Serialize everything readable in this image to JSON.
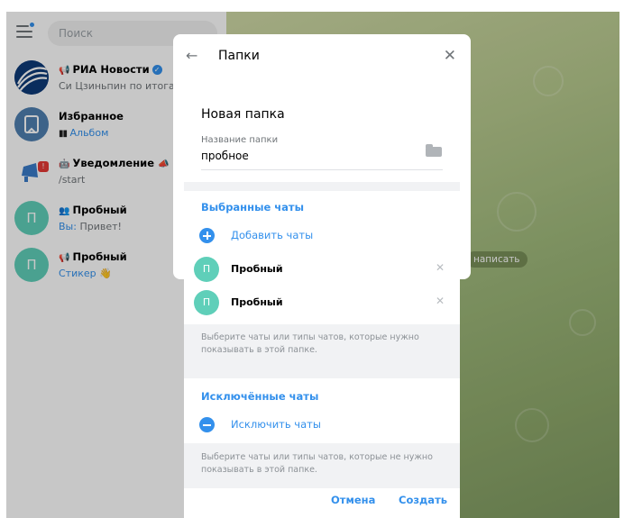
{
  "sidebar": {
    "search_placeholder": "Поиск",
    "chats": [
      {
        "title": "РИА Новости",
        "prefix": "📢",
        "subtitle": "Си Цзиньпин по итогам",
        "avatar": "",
        "color": "#1a4a8a"
      },
      {
        "title": "Избранное",
        "subtitle_blocks": "▮▮",
        "subtitle": "Альбом",
        "avatar": "",
        "color": "#4f7fb0"
      },
      {
        "title": "Уведомление",
        "prefix": "🤖",
        "title_suffix": "📣",
        "subtitle": "/start",
        "badge": "!",
        "color": "#6aa0d8"
      },
      {
        "title": "Пробный",
        "prefix": "👥",
        "sender": "Вы:",
        "subtitle": "Привет!",
        "avatar": "П",
        "color": "#5fcfb9"
      },
      {
        "title": "Пробный",
        "prefix": "📢",
        "subtitle": "Стикер 👋",
        "avatar": "П",
        "color": "#5fcfb9"
      }
    ]
  },
  "folders_panel": {
    "title": "Папки"
  },
  "write_pill": "написать",
  "dialog": {
    "title": "Новая папка",
    "folder_name_label": "Название папки",
    "folder_name_value": "пробное",
    "included_title": "Выбранные чаты",
    "add_chats": "Добавить чаты",
    "selected": [
      {
        "avatar": "П",
        "name": "Пробный"
      },
      {
        "avatar": "П",
        "name": "Пробный"
      }
    ],
    "included_hint": "Выберите чаты или типы чатов, которые нужно показывать в этой папке.",
    "excluded_title": "Исключённые чаты",
    "exclude_chats": "Исключить чаты",
    "excluded_hint": "Выберите чаты или типы чатов, которые не нужно показывать в этой папке.",
    "cancel": "Отмена",
    "create": "Создать"
  },
  "colors": {
    "accent": "#3390ec",
    "avatar_teal": "#5fcfb9"
  }
}
